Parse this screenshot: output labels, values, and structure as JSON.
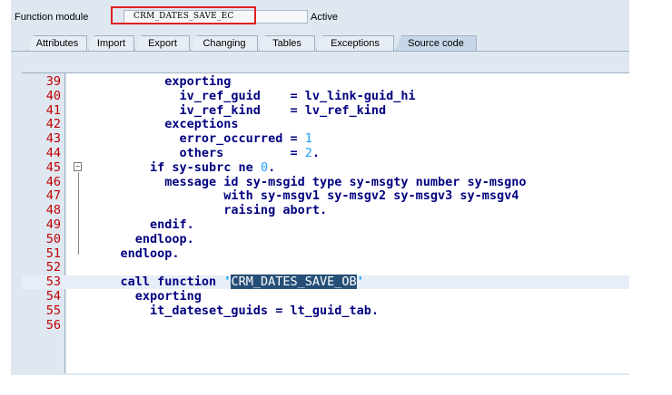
{
  "header": {
    "label": "Function module",
    "function_name": "CRM_DATES_SAVE_EC",
    "status": "Active"
  },
  "tabs": [
    {
      "label": "Attributes",
      "active": false
    },
    {
      "label": "Import",
      "active": false
    },
    {
      "label": "Export",
      "active": false
    },
    {
      "label": "Changing",
      "active": false
    },
    {
      "label": "Tables",
      "active": false
    },
    {
      "label": "Exceptions",
      "active": false
    },
    {
      "label": "Source code",
      "active": true
    }
  ],
  "code_lines": [
    {
      "num": "39",
      "parts": [
        {
          "t": "          exporting"
        }
      ]
    },
    {
      "num": "40",
      "parts": [
        {
          "t": "            iv_ref_guid    = lv_link-guid_hi"
        }
      ]
    },
    {
      "num": "41",
      "parts": [
        {
          "t": "            iv_ref_kind    = lv_ref_kind"
        }
      ]
    },
    {
      "num": "42",
      "parts": [
        {
          "t": "          exceptions"
        }
      ]
    },
    {
      "num": "43",
      "parts": [
        {
          "t": "            error_occurred = "
        },
        {
          "t": "1",
          "c": "num"
        }
      ]
    },
    {
      "num": "44",
      "parts": [
        {
          "t": "            others         = "
        },
        {
          "t": "2",
          "c": "num"
        },
        {
          "t": "."
        }
      ]
    },
    {
      "num": "45",
      "parts": [
        {
          "t": "        if sy-subrc ne "
        },
        {
          "t": "0",
          "c": "num"
        },
        {
          "t": "."
        }
      ]
    },
    {
      "num": "46",
      "parts": [
        {
          "t": "          message id sy-msgid type sy-msgty number sy-msgno"
        }
      ]
    },
    {
      "num": "47",
      "parts": [
        {
          "t": "                  with sy-msgv1 sy-msgv2 sy-msgv3 sy-msgv4"
        }
      ]
    },
    {
      "num": "48",
      "parts": [
        {
          "t": "                  raising abort."
        }
      ]
    },
    {
      "num": "49",
      "parts": [
        {
          "t": "        endif."
        }
      ]
    },
    {
      "num": "50",
      "parts": [
        {
          "t": "      endloop."
        }
      ]
    },
    {
      "num": "51",
      "parts": [
        {
          "t": "    endloop."
        }
      ]
    },
    {
      "num": "52",
      "parts": [
        {
          "t": ""
        }
      ]
    },
    {
      "num": "53",
      "parts": [
        {
          "t": "    call function "
        },
        {
          "t": "'",
          "c": "str"
        },
        {
          "t": "CRM_DATES_SAVE_OB",
          "c": "sel"
        },
        {
          "t": "'",
          "c": "str"
        }
      ],
      "highlight": true
    },
    {
      "num": "54",
      "parts": [
        {
          "t": "      exporting"
        }
      ]
    },
    {
      "num": "55",
      "parts": [
        {
          "t": "        it_dateset_guids = lt_guid_tab."
        }
      ]
    },
    {
      "num": "56",
      "parts": [
        {
          "t": ""
        }
      ]
    }
  ],
  "icons": {
    "collapse_marker": "collapse-box-icon"
  }
}
